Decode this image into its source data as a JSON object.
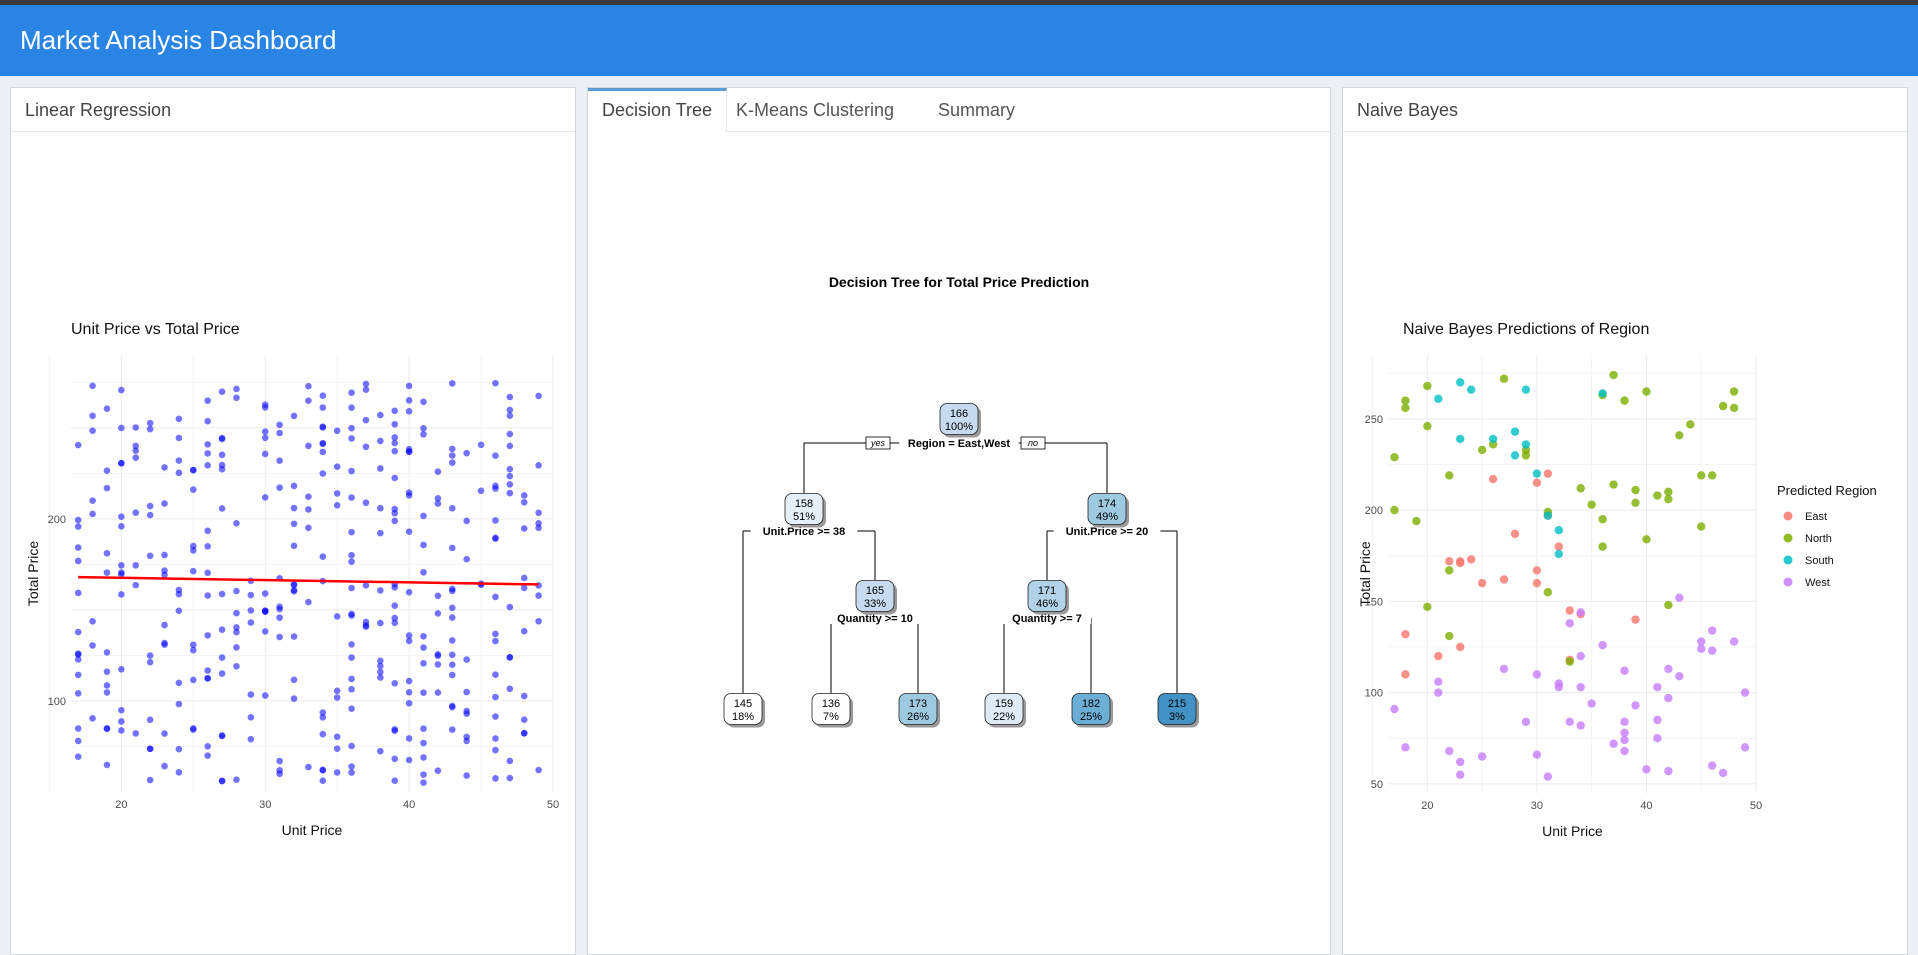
{
  "app": {
    "title": "Market Analysis Dashboard"
  },
  "left_panel": {
    "title": "Linear Regression"
  },
  "middle_panel": {
    "tabs": [
      {
        "label": "Decision Tree",
        "active": true
      },
      {
        "label": "K-Means Clustering",
        "active": false
      },
      {
        "label": "Summary",
        "active": false
      }
    ]
  },
  "right_panel": {
    "title": "Naive Bayes"
  },
  "colors": {
    "header": "#2a84e4",
    "regression_points": "#0000ff",
    "regression_line": "#ff0000",
    "east": "#f8766d",
    "north": "#7cae00",
    "south": "#00bfc4",
    "west": "#c77cff"
  },
  "chart_data": [
    {
      "type": "scatter",
      "title": "Unit Price vs Total Price",
      "xlabel": "Unit Price",
      "ylabel": "Total Price",
      "xlim": [
        16.5,
        50
      ],
      "ylim": [
        50,
        290
      ],
      "xticks": [
        20,
        30,
        40,
        50
      ],
      "yticks": [
        100,
        200
      ],
      "grid": true,
      "point_count": 400,
      "regression_line": [
        [
          17,
          168
        ],
        [
          49,
          164
        ]
      ]
    },
    {
      "type": "tree",
      "title": "Decision Tree for Total Price Prediction",
      "branch_labels": {
        "yes": "yes",
        "no": "no"
      },
      "nodes": [
        {
          "value": "166",
          "pct": "100%",
          "split": "Region = East,West"
        },
        {
          "value": "158",
          "pct": "51%",
          "split": "Unit.Price >= 38"
        },
        {
          "value": "174",
          "pct": "49%",
          "split": "Unit.Price >= 20"
        },
        {
          "value": "165",
          "pct": "33%",
          "split": "Quantity >= 10"
        },
        {
          "value": "171",
          "pct": "46%",
          "split": "Quantity >= 7"
        },
        {
          "value": "145",
          "pct": "18%"
        },
        {
          "value": "136",
          "pct": "7%"
        },
        {
          "value": "173",
          "pct": "26%"
        },
        {
          "value": "159",
          "pct": "22%"
        },
        {
          "value": "182",
          "pct": "25%"
        },
        {
          "value": "215",
          "pct": "3%"
        }
      ]
    },
    {
      "type": "scatter",
      "title": "Naive Bayes Predictions of Region",
      "xlabel": "Unit Price",
      "ylabel": "Total Price",
      "xlim": [
        16.5,
        50
      ],
      "ylim": [
        45,
        285
      ],
      "xticks": [
        20,
        30,
        40,
        50
      ],
      "yticks": [
        50,
        100,
        150,
        200,
        250
      ],
      "grid": true,
      "legend": {
        "title": "Predicted Region",
        "placement": "right",
        "entries": [
          "East",
          "North",
          "South",
          "West"
        ]
      },
      "series": [
        {
          "name": "East",
          "points": [
            [
              18,
              132
            ],
            [
              18,
              110
            ],
            [
              21,
              120
            ],
            [
              22,
              172
            ],
            [
              23,
              172
            ],
            [
              23,
              125
            ],
            [
              24,
              173
            ],
            [
              25,
              160
            ],
            [
              26,
              217
            ],
            [
              27,
              162
            ],
            [
              28,
              187
            ],
            [
              30,
              215
            ],
            [
              30,
              167
            ],
            [
              30,
              160
            ],
            [
              31,
              220
            ],
            [
              32,
              180
            ],
            [
              33,
              145
            ],
            [
              33,
              118
            ],
            [
              34,
              143
            ],
            [
              39,
              140
            ],
            [
              31,
              197
            ],
            [
              23,
              171
            ]
          ]
        },
        {
          "name": "North",
          "points": [
            [
              17,
              229
            ],
            [
              17,
              200
            ],
            [
              18,
              260
            ],
            [
              18,
              256
            ],
            [
              19,
              194
            ],
            [
              20,
              268
            ],
            [
              20,
              147
            ],
            [
              20,
              246
            ],
            [
              22,
              219
            ],
            [
              22,
              131
            ],
            [
              22,
              167
            ],
            [
              25,
              233
            ],
            [
              26,
              236
            ],
            [
              27,
              272
            ],
            [
              29,
              230
            ],
            [
              31,
              155
            ],
            [
              31,
              199
            ],
            [
              33,
              117
            ],
            [
              34,
              212
            ],
            [
              35,
              203
            ],
            [
              36,
              195
            ],
            [
              36,
              180
            ],
            [
              36,
              263
            ],
            [
              37,
              274
            ],
            [
              37,
              214
            ],
            [
              38,
              260
            ],
            [
              39,
              211
            ],
            [
              39,
              204
            ],
            [
              40,
              265
            ],
            [
              40,
              184
            ],
            [
              41,
              208
            ],
            [
              42,
              210
            ],
            [
              42,
              206
            ],
            [
              42,
              148
            ],
            [
              43,
              241
            ],
            [
              44,
              247
            ],
            [
              45,
              219
            ],
            [
              45,
              191
            ],
            [
              46,
              219
            ],
            [
              47,
              257
            ],
            [
              48,
              256
            ],
            [
              48,
              265
            ],
            [
              29,
              233
            ]
          ]
        },
        {
          "name": "South",
          "points": [
            [
              21,
              261
            ],
            [
              23,
              270
            ],
            [
              24,
              266
            ],
            [
              23,
              239
            ],
            [
              26,
              239
            ],
            [
              28,
              243
            ],
            [
              28,
              230
            ],
            [
              29,
              266
            ],
            [
              30,
              220
            ],
            [
              31,
              197
            ],
            [
              32,
              189
            ],
            [
              32,
              176
            ],
            [
              36,
              264
            ],
            [
              29,
              236
            ]
          ]
        },
        {
          "name": "West",
          "points": [
            [
              17,
              91
            ],
            [
              18,
              70
            ],
            [
              21,
              106
            ],
            [
              21,
              100
            ],
            [
              22,
              68
            ],
            [
              23,
              62
            ],
            [
              23,
              55
            ],
            [
              25,
              65
            ],
            [
              27,
              113
            ],
            [
              29,
              84
            ],
            [
              30,
              66
            ],
            [
              30,
              110
            ],
            [
              31,
              54
            ],
            [
              32,
              103
            ],
            [
              33,
              138
            ],
            [
              33,
              84
            ],
            [
              34,
              120
            ],
            [
              34,
              82
            ],
            [
              34,
              144
            ],
            [
              35,
              94
            ],
            [
              36,
              126
            ],
            [
              37,
              72
            ],
            [
              38,
              112
            ],
            [
              38,
              84
            ],
            [
              38,
              74
            ],
            [
              38,
              68
            ],
            [
              38,
              78
            ],
            [
              39,
              93
            ],
            [
              40,
              58
            ],
            [
              41,
              75
            ],
            [
              41,
              85
            ],
            [
              41,
              103
            ],
            [
              42,
              113
            ],
            [
              42,
              57
            ],
            [
              42,
              97
            ],
            [
              43,
              109
            ],
            [
              43,
              152
            ],
            [
              45,
              124
            ],
            [
              45,
              128
            ],
            [
              46,
              123
            ],
            [
              46,
              134
            ],
            [
              46,
              60
            ],
            [
              47,
              56
            ],
            [
              48,
              128
            ],
            [
              49,
              100
            ],
            [
              49,
              70
            ],
            [
              34,
              103
            ],
            [
              32,
              105
            ]
          ]
        }
      ]
    }
  ]
}
